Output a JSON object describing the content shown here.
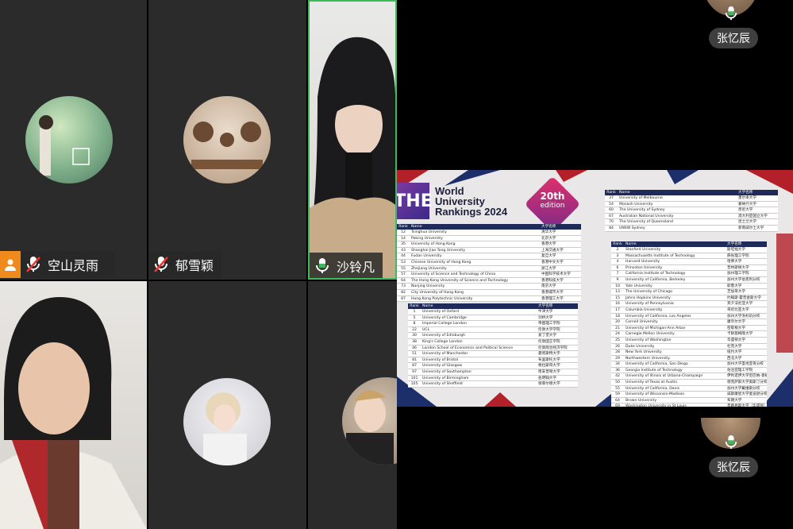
{
  "participants": [
    {
      "name": "空山灵雨",
      "muted": true
    },
    {
      "name": "郁雪颖",
      "muted": true
    },
    {
      "name": "沙铃凡",
      "muted": false
    }
  ],
  "side_participants": [
    {
      "name": "张忆辰"
    },
    {
      "name": "张忆辰"
    }
  ],
  "slide": {
    "logo": "THE",
    "title_lines": [
      "World",
      "University",
      "Rankings 2024"
    ],
    "badge_num": "20th",
    "badge_text": "edition",
    "headers": [
      "Rank",
      "Name",
      "大学名称"
    ],
    "table_a": [
      [
        "12",
        "Tsinghua University",
        "清华大学"
      ],
      [
        "14",
        "Peking University",
        "北京大学"
      ],
      [
        "35",
        "University of Hong Kong",
        "香港大学"
      ],
      [
        "43",
        "Shanghai Jiao Tong University",
        "上海交通大学"
      ],
      [
        "44",
        "Fudan University",
        "复旦大学"
      ],
      [
        "53",
        "Chinese University of Hong Kong",
        "香港中文大学"
      ],
      [
        "55",
        "Zhejiang University",
        "浙江大学"
      ],
      [
        "57",
        "University of Science and Technology of China",
        "中国科学技术大学"
      ],
      [
        "64",
        "The Hong Kong University of Science and Technology",
        "香港科技大学"
      ],
      [
        "73",
        "Nanjing University",
        "南京大学"
      ],
      [
        "82",
        "City University of Hong Kong",
        "香港城市大学"
      ],
      [
        "87",
        "Hong Kong Polytechnic University",
        "香港理工大学"
      ]
    ],
    "table_b": [
      [
        "1",
        "University of Oxford",
        "牛津大学"
      ],
      [
        "5",
        "University of Cambridge",
        "剑桥大学"
      ],
      [
        "8",
        "Imperial College London",
        "帝国理工学院"
      ],
      [
        "22",
        "UCL",
        "伦敦大学学院"
      ],
      [
        "30",
        "University of Edinburgh",
        "爱丁堡大学"
      ],
      [
        "38",
        "King's College London",
        "伦敦国王学院"
      ],
      [
        "46",
        "London School of Economics and Political Science",
        "伦敦政治经济学院"
      ],
      [
        "51",
        "University of Manchester",
        "曼彻斯特大学"
      ],
      [
        "81",
        "University of Bristol",
        "布里斯托大学"
      ],
      [
        "87",
        "University of Glasgow",
        "格拉斯哥大学"
      ],
      [
        "97",
        "University of Southampton",
        "南安普顿大学"
      ],
      [
        "101",
        "University of Birmingham",
        "伯明翰大学"
      ],
      [
        "105",
        "University of Sheffield",
        "谢菲尔德大学"
      ]
    ],
    "table_c": [
      [
        "37",
        "University of Melbourne",
        "墨尔本大学"
      ],
      [
        "54",
        "Monash University",
        "蒙纳什大学"
      ],
      [
        "60",
        "The University of Sydney",
        "悉尼大学"
      ],
      [
        "67",
        "Australian National University",
        "澳大利亚国立大学"
      ],
      [
        "70",
        "The University of Queensland",
        "昆士兰大学"
      ],
      [
        "84",
        "UNSW Sydney",
        "新南威尔士大学"
      ]
    ],
    "table_d": [
      [
        "2",
        "Stanford University",
        "斯坦福大学"
      ],
      [
        "3",
        "Massachusetts Institute of Technology",
        "麻省理工学院"
      ],
      [
        "4",
        "Harvard University",
        "哈佛大学"
      ],
      [
        "6",
        "Princeton University",
        "普林斯顿大学"
      ],
      [
        "7",
        "California Institute of Technology",
        "加州理工学院"
      ],
      [
        "9",
        "University of California, Berkeley",
        "加州大学伯克利分校"
      ],
      [
        "10",
        "Yale University",
        "耶鲁大学"
      ],
      [
        "13",
        "The University of Chicago",
        "芝加哥大学"
      ],
      [
        "15",
        "Johns Hopkins University",
        "约翰斯·霍普金斯大学"
      ],
      [
        "16",
        "University of Pennsylvania",
        "宾夕法尼亚大学"
      ],
      [
        "17",
        "Columbia University",
        "哥伦比亚大学"
      ],
      [
        "18",
        "University of California, Los Angeles",
        "加州大学洛杉矶分校"
      ],
      [
        "20",
        "Cornell University",
        "康奈尔大学"
      ],
      [
        "21",
        "University of Michigan-Ann Arbor",
        "密歇根大学"
      ],
      [
        "24",
        "Carnegie Mellon University",
        "卡耐基梅隆大学"
      ],
      [
        "25",
        "University of Washington",
        "华盛顿大学"
      ],
      [
        "26",
        "Duke University",
        "杜克大学"
      ],
      [
        "28",
        "New York University",
        "纽约大学"
      ],
      [
        "29",
        "Northwestern University",
        "西北大学"
      ],
      [
        "34",
        "University of California, San Diego",
        "加州大学圣地亚哥分校"
      ],
      [
        "36",
        "Georgia Institute of Technology",
        "佐治亚理工学院"
      ],
      [
        "42",
        "University of Illinois at Urbana-Champaign",
        "伊利诺伊大学厄巴纳-香槟分校"
      ],
      [
        "50",
        "University of Texas at Austin",
        "德克萨斯大学奥斯汀分校"
      ],
      [
        "55",
        "University of California, Davis",
        "加州大学戴维斯分校"
      ],
      [
        "59",
        "University of Wisconsin-Madison",
        "威斯康星大学麦迪逊分校"
      ],
      [
        "64",
        "Brown University",
        "布朗大学"
      ],
      [
        "69",
        "Washington University in St Louis",
        "圣路易斯大学（华盛顿）"
      ]
    ]
  }
}
